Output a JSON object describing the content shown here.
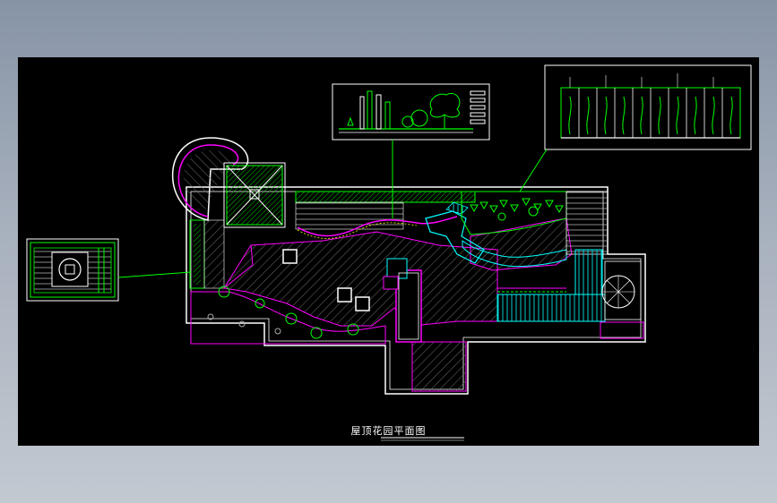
{
  "drawing": {
    "title": "屋顶花园平面图"
  },
  "colors": {
    "background": "#000000",
    "outline": "#ffffff",
    "planting": "#00ff00",
    "edge": "#ff00ff",
    "water": "#00ffff",
    "leader": "#00ff00"
  },
  "details": [
    {
      "name": "pavilion-plan-detail"
    },
    {
      "name": "elevation-detail"
    },
    {
      "name": "trellis-elevation-detail"
    }
  ]
}
